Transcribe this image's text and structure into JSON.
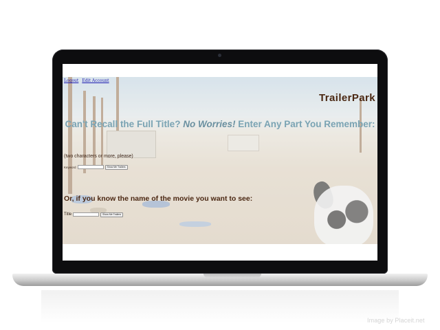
{
  "nav": {
    "logout": "Logout",
    "edit_account": "Edit Account"
  },
  "brand": "TrailerPark",
  "headline": {
    "part1": "Can't Recall the Full Title? ",
    "emphasis": "No Worries!",
    "part2": " Enter Any Part You Remember:"
  },
  "keyword_search": {
    "hint": "(two characters or more, please)",
    "label": "Keyword",
    "value": "",
    "button": "Show Me Trailers"
  },
  "title_search": {
    "heading": "Or, if you know the name of the movie you want to see:",
    "label": "Title",
    "value": "",
    "button": "Show Me Trailers"
  },
  "watermark": "Image by Placeit.net",
  "colors": {
    "brand": "#4a2712",
    "headline": "#7aa3b3",
    "link": "#1b1bb0",
    "laptop_bezel": "#0d0d0f"
  }
}
